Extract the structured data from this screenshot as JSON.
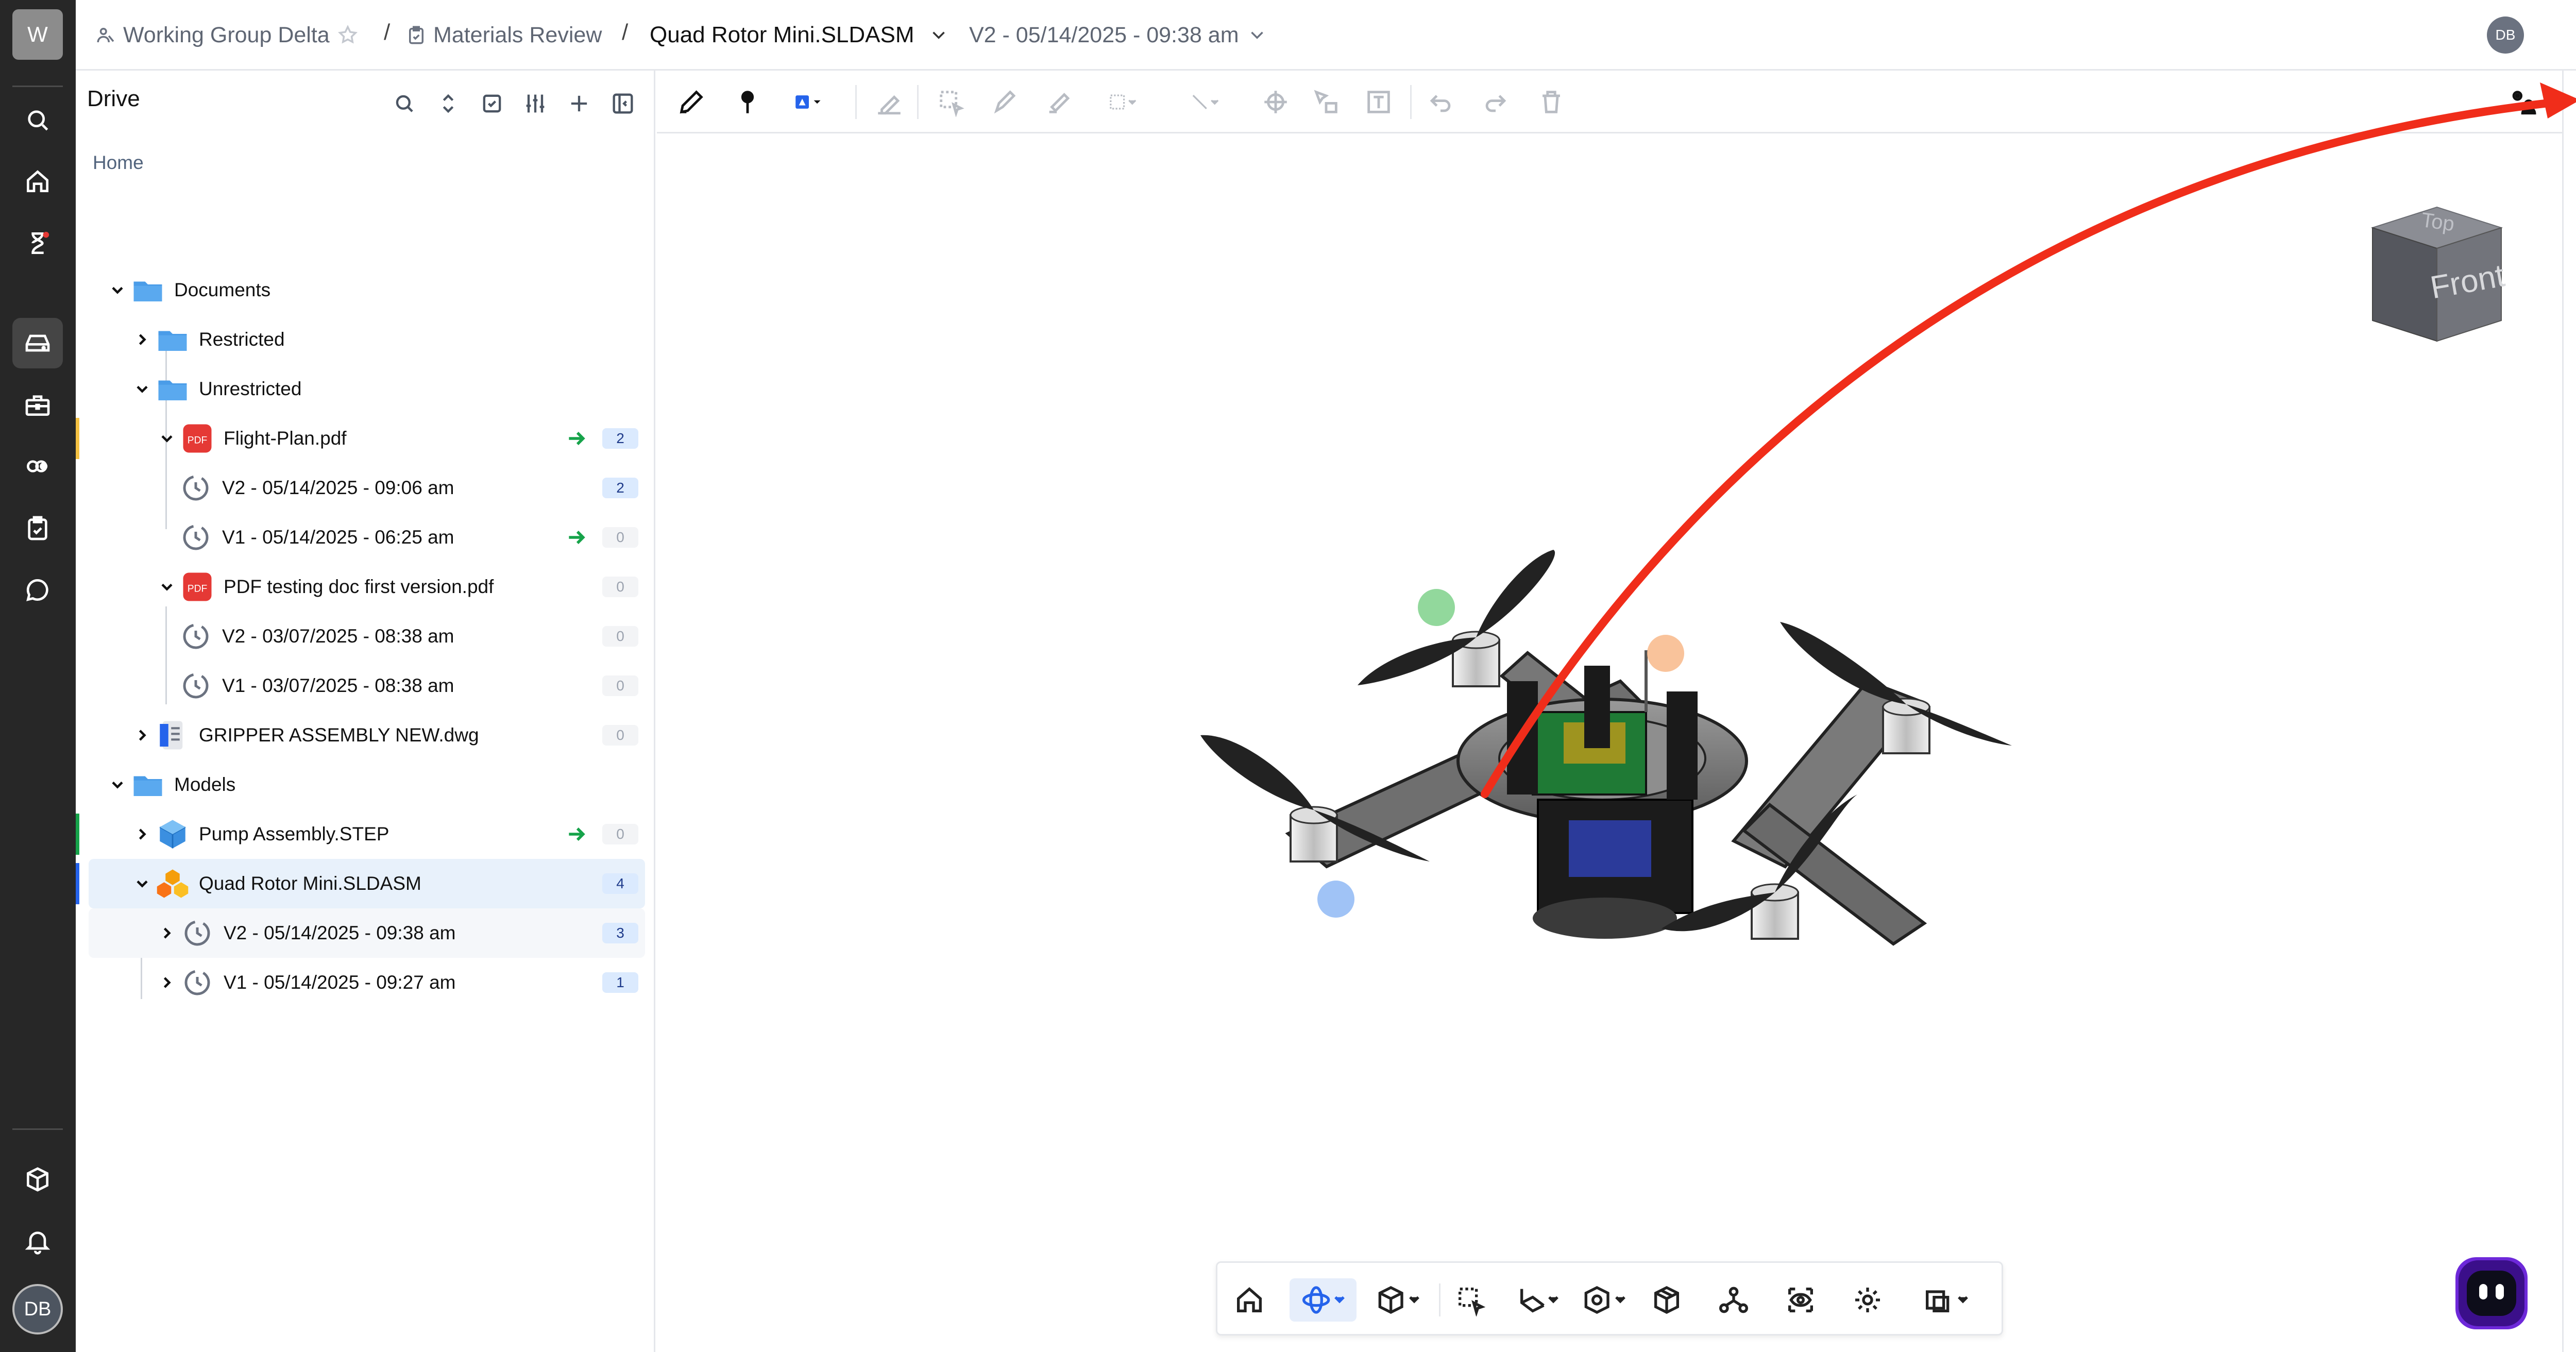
{
  "workspace": {
    "initial": "W"
  },
  "user": {
    "initials": "DB"
  },
  "breadcrumb": {
    "project": "Working Group Delta",
    "review": "Materials Review",
    "file": "Quad Rotor Mini.SLDASM",
    "version": "V2 - 05/14/2025 - 09:38 am"
  },
  "header": {
    "share_count": "1",
    "avatar": "DB"
  },
  "sidebar": {
    "title": "Drive",
    "home": "Home",
    "tree": [
      {
        "label": "Documents",
        "type": "folder",
        "level": 0,
        "expanded": true
      },
      {
        "label": "Restricted",
        "type": "folder",
        "level": 1,
        "expanded": false
      },
      {
        "label": "Unrestricted",
        "type": "folder",
        "level": 1,
        "expanded": true
      },
      {
        "label": "Flight-Plan.pdf",
        "type": "pdf",
        "level": 2,
        "expanded": true,
        "count": "2",
        "accent": "#f5c242",
        "arrow": true
      },
      {
        "label": "V2 - 05/14/2025 - 09:06 am",
        "type": "version",
        "level": 3,
        "count": "2"
      },
      {
        "label": "V1 - 05/14/2025 - 06:25 am",
        "type": "version",
        "level": 3,
        "count": "0",
        "arrow": true
      },
      {
        "label": "PDF testing doc first version.pdf",
        "type": "pdf",
        "level": 2,
        "expanded": true,
        "count": "0"
      },
      {
        "label": "V2 - 03/07/2025 - 08:38 am",
        "type": "version",
        "level": 3,
        "count": "0"
      },
      {
        "label": "V1 - 03/07/2025 - 08:38 am",
        "type": "version",
        "level": 3,
        "count": "0"
      },
      {
        "label": "GRIPPER ASSEMBLY NEW.dwg",
        "type": "dwg",
        "level": 1,
        "expanded": false,
        "count": "0"
      },
      {
        "label": "Models",
        "type": "folder",
        "level": 0,
        "expanded": true
      },
      {
        "label": "Pump Assembly.STEP",
        "type": "step",
        "level": 1,
        "expanded": false,
        "count": "0",
        "accent": "#16a34a",
        "arrow": true
      },
      {
        "label": "Quad Rotor Mini.SLDASM",
        "type": "asm",
        "level": 1,
        "expanded": true,
        "count": "4",
        "accent": "#2563eb",
        "selected": true
      },
      {
        "label": "V2 - 05/14/2025 - 09:38 am",
        "type": "version",
        "level": 2,
        "expanded": false,
        "count": "3",
        "hover": true
      },
      {
        "label": "V1 - 05/14/2025 - 09:27 am",
        "type": "version",
        "level": 2,
        "expanded": false,
        "count": "1"
      }
    ]
  },
  "viewer": {
    "viewcube": {
      "top": "Top",
      "front": "Front"
    },
    "comment_count": "3"
  },
  "colors": {
    "rail_bg": "#272727",
    "selected_row": "#e8f1fb",
    "annotation_arrow": "#f02d1a",
    "accent_blue": "#2563eb"
  },
  "icons": {
    "toolbar": [
      "pencil-icon",
      "pin-icon",
      "shape-fill-icon",
      "eraser-icon",
      "select-box-icon",
      "pen-icon",
      "highlighter-icon",
      "marquee-icon",
      "line-icon",
      "crosshair-icon",
      "cursor-box-icon",
      "text-box-icon",
      "undo-icon",
      "redo-icon",
      "trash-icon"
    ],
    "bottom": [
      "home-view-icon",
      "orbit-icon",
      "cube-view-icon",
      "box-select-icon",
      "section-icon",
      "explode-icon",
      "model-icon",
      "tree-icon",
      "visibility-icon",
      "settings-icon",
      "layers-icon"
    ]
  }
}
